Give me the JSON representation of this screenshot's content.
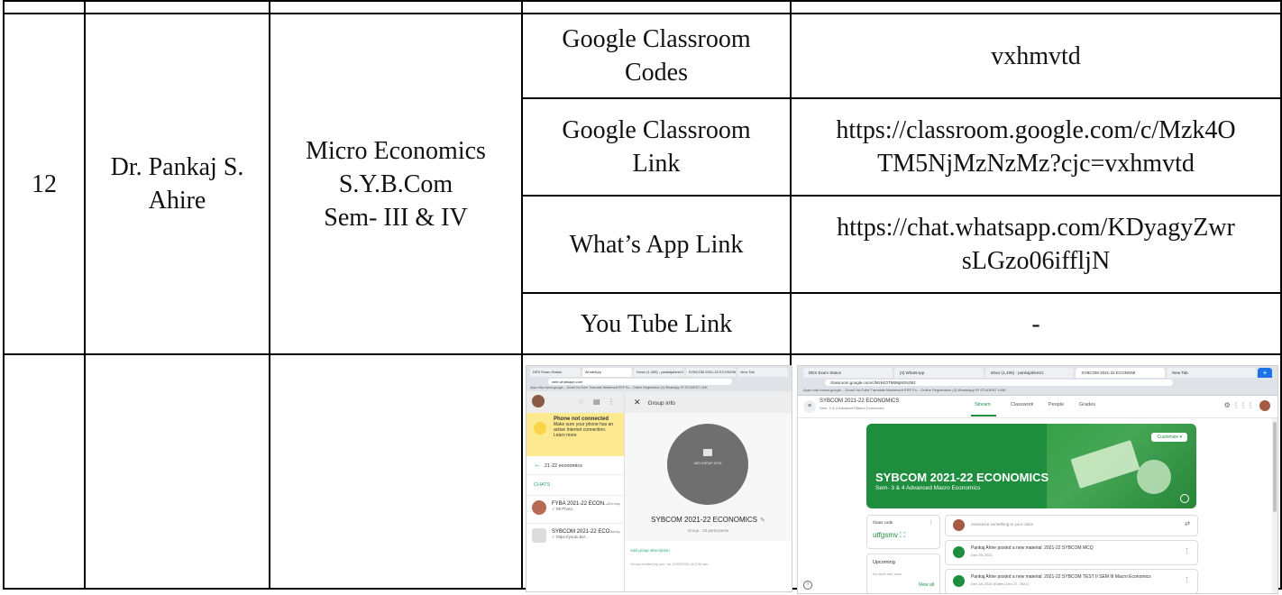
{
  "row": {
    "sr_no": "12",
    "teacher_line1": "Dr. Pankaj S.",
    "teacher_line2": "Ahire",
    "subject_line1": "Micro Economics",
    "subject_line2": "S.Y.B.Com",
    "subject_line3": "Sem- III & IV",
    "links": [
      {
        "type_line1": "Google Classroom",
        "type_line2": "Codes",
        "value_line1": "vxhmvtd",
        "value_line2": ""
      },
      {
        "type_line1": "Google Classroom",
        "type_line2": "Link",
        "value_line1": "https://classroom.google.com/c/Mzk4O",
        "value_line2": "TM5NjMzNzMz?cjc=vxhmvtd"
      },
      {
        "type_line1": "What’s App Link",
        "type_line2": "",
        "value_line1": "https://chat.whatsapp.com/KDyagyZwr",
        "value_line2": "sLGzo06iffljN"
      },
      {
        "type_line1": "You Tube Link",
        "type_line2": "",
        "value_line1": "-",
        "value_line2": ""
      }
    ]
  },
  "whatsapp_shot": {
    "tabs": [
      "DES Exam Status",
      "WhatsApp",
      "Inbox (1,405) - pankajahire21",
      "SYBCOM 2021-22 ECONOMICS",
      "New Tab"
    ],
    "url": "web.whatsapp.com",
    "bookmarks": "Apps   http://www.google...   Gmail   YouTube   Translate   Mastersoft ERP Ex...   Online Registration   (2) WhatsApp   IR STUDENT LINK",
    "warning_title": "Phone not connected",
    "warning_body": "Make sure your phone has an active Internet connection.",
    "warning_link": "Learn more",
    "search": "21-22 economics",
    "chats_label": "CHATS",
    "chats": [
      {
        "title": "FYBA 2021-22 ECON...",
        "sub": "✓ 89 Photo",
        "time": "Monday"
      },
      {
        "title": "SYBCOM 2021-22 ECO...",
        "sub": "✓ https://youtu.be/...",
        "time": "Friday"
      }
    ],
    "header_title": "Group info",
    "add_icon_label": "ADD GROUP ICON",
    "group_name": "SYBCOM 2021-22 ECONOMICS",
    "group_sub": "Group · 33 participants",
    "desc_link": "Add group description",
    "desc_meta": "Group created by you, on 10/03/2021 at 2:36 am"
  },
  "classroom_shot": {
    "tabs": [
      "DES Exam Status",
      "(3) WhatsApp",
      "Inbox (1,405) - pankajahire21",
      "SYBCOM 2021-22 ECONOMI",
      "New Tab"
    ],
    "new_tab": "+",
    "url": "classroom.google.com/c/Mzk4OTM5NjMzNzMz",
    "bookmarks": "Apps   http://www.google...   Gmail   YouTube   Translate   Mastersoft ERP Ex...   Online Registration   (2) WhatsApp   IR STUDENT LINK",
    "class_name": "SYBCOM 2021-22 ECONOMICS",
    "class_section": "Sem- 3 & 4 Advanced Macro Economics",
    "nav": [
      "Stream",
      "Classwork",
      "People",
      "Grades"
    ],
    "customize": "Customize ▾",
    "banner_title": "SYBCOM 2021-22 ECONOMICS",
    "banner_sub": "Sem- 3 & 4 Advanced Macro Economics",
    "class_code_label": "Class code",
    "class_code": "utfgsmv ⛶",
    "upcoming_label": "Upcoming",
    "upcoming_sub": "No work due soon",
    "view_all": "View all",
    "announce": "Announce something to your class",
    "posts": [
      {
        "title": "Pankaj Ahire posted a new material: 2021-22 SYBCOM MCQ",
        "date": "Dec 29, 2021"
      },
      {
        "title": "Pankaj Ahire posted a new material: 2021-22 SYBCOM TEST II SEM III Macro Economics",
        "date": "Dec 18, 2021 (Edited Dec 27, 2021)"
      }
    ]
  }
}
